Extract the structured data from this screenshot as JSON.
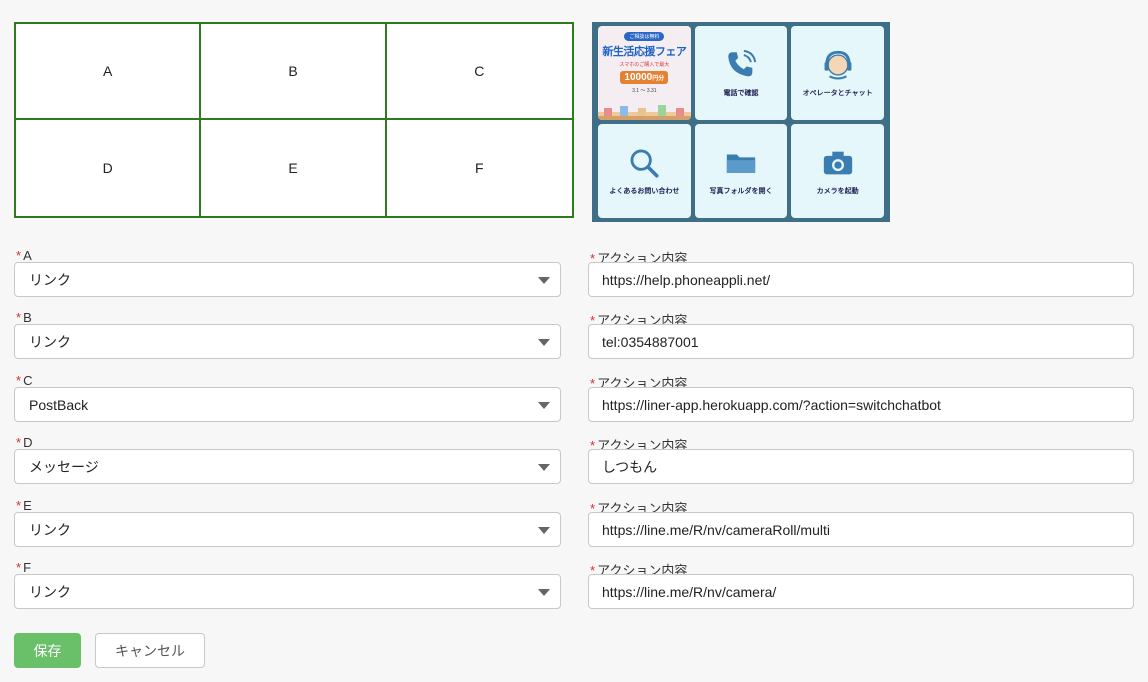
{
  "grid": {
    "cells": [
      "A",
      "B",
      "C",
      "D",
      "E",
      "F"
    ]
  },
  "preview": {
    "banner": {
      "badge": "ご相談は無料",
      "title": "新生活応援フェア",
      "subtitle": "スマホのご購入で最大",
      "amount": "10000",
      "amount_unit": "円分",
      "date": "3.1 〜 3.31"
    },
    "tiles": [
      {
        "icon": "phone-icon",
        "label": "電話で確認"
      },
      {
        "icon": "operator-icon",
        "label": "オペレータとチャット"
      },
      {
        "icon": "search-icon",
        "label": "よくあるお問い合わせ"
      },
      {
        "icon": "folder-icon",
        "label": "写真フォルダを開く"
      },
      {
        "icon": "camera-icon",
        "label": "カメラを起動"
      }
    ]
  },
  "form": {
    "action_label": "アクション内容",
    "rows": [
      {
        "label": "A",
        "type": "リンク",
        "value": "https://help.phoneappli.net/"
      },
      {
        "label": "B",
        "type": "リンク",
        "value": "tel:0354887001"
      },
      {
        "label": "C",
        "type": "PostBack",
        "value": "https://liner-app.herokuapp.com/?action=switchchatbot"
      },
      {
        "label": "D",
        "type": "メッセージ",
        "value": "しつもん"
      },
      {
        "label": "E",
        "type": "リンク",
        "value": "https://line.me/R/nv/cameraRoll/multi"
      },
      {
        "label": "F",
        "type": "リンク",
        "value": "https://line.me/R/nv/camera/"
      }
    ]
  },
  "buttons": {
    "save": "保存",
    "cancel": "キャンセル"
  },
  "colors": {
    "grid_border": "#2d7a1f",
    "save_button": "#6abf69",
    "required_mark": "#e02b2b",
    "preview_bg": "#3f6f86"
  }
}
